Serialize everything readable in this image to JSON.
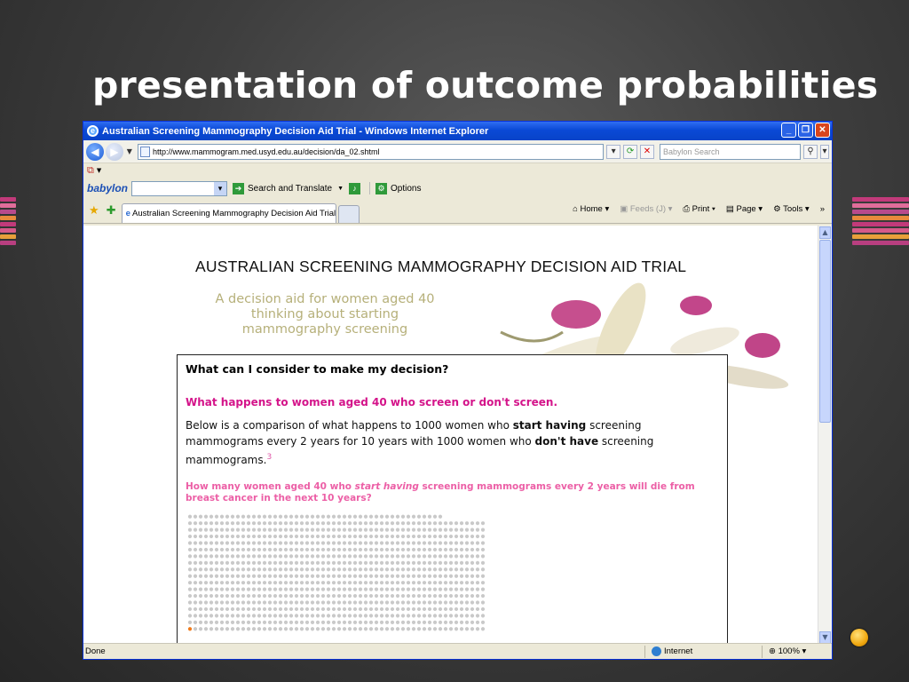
{
  "slide": {
    "title": "presentation of outcome probabilities"
  },
  "window": {
    "title": "Australian Screening Mammography Decision Aid Trial - Windows Internet Explorer",
    "address": "http://www.mammogram.med.usyd.edu.au/decision/da_02.shtml",
    "search_placeholder": "Babylon Search",
    "babylon": {
      "logo": "babylon",
      "search_translate": "Search and Translate",
      "options": "Options"
    },
    "tab_label": "Australian Screening Mammography Decision Aid Trial",
    "commands": {
      "home": "Home",
      "feeds": "Feeds (J)",
      "print": "Print",
      "page": "Page",
      "tools": "Tools"
    },
    "status": {
      "text": "Done",
      "zone": "Internet",
      "zoom": "100%"
    }
  },
  "page": {
    "header": "AUSTRALIAN SCREENING MAMMOGRAPHY DECISION AID TRIAL",
    "tagline": [
      "A decision aid for women aged 40",
      "thinking about starting",
      "mammography screening"
    ],
    "panel": {
      "question": "What can I consider to make my decision?",
      "subheading": "What happens to women aged 40 who screen or don't screen.",
      "body": {
        "part1": "Below is a comparison of what happens to 1000 women who ",
        "bold1": "start having",
        "part2": " screening mammograms every 2 years for 10 years with 1000 women who ",
        "bold2": "don't have",
        "part3": " screening mammograms.",
        "ref": "3"
      },
      "pink_question": {
        "part1": "How many women aged 40 who ",
        "italic": "start having",
        "part2": " screening mammograms every 2 years will die from breast cancer in the next 10 years?"
      }
    },
    "dot_grid": {
      "total": 1000,
      "highlighted": 1,
      "dot_color": "#c9c9c9",
      "highlight_color": "#f07a1a"
    }
  },
  "colors": {
    "accent_pink": "#d4148a",
    "light_pink": "#ec5fa6",
    "tagline": "#b6b07a",
    "xp_blue": "#0a49d6"
  }
}
